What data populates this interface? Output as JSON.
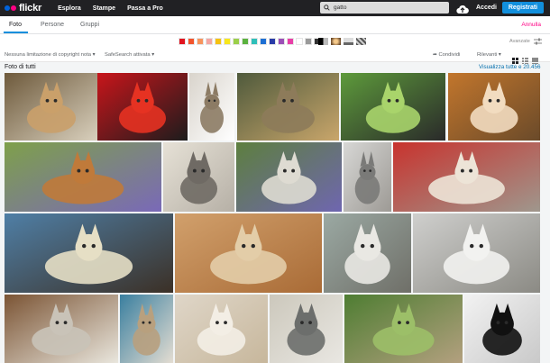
{
  "app": {
    "name": "flickr",
    "nav": [
      "Esplora",
      "Stampe",
      "Passa a Pro"
    ],
    "search_value": "gatto",
    "login_label": "Accedi",
    "signup_label": "Registrati"
  },
  "tabs": {
    "items": [
      "Foto",
      "Persone",
      "Gruppi"
    ],
    "active": "Foto",
    "cancel_label": "Annulla"
  },
  "filters": {
    "colors": [
      "#e1141f",
      "#f2542d",
      "#f7945d",
      "#f4a6a3",
      "#f5c211",
      "#f8e71c",
      "#9bcf4a",
      "#5bb23f",
      "#2fbfb9",
      "#1d6fd3",
      "#293ca7",
      "#9b4fb6",
      "#e83ea7",
      "#ffffff",
      "#9a9a9a",
      "#333333"
    ],
    "tones_icons": [
      "bw-icon",
      "shallow-depth-icon",
      "minimal-icon",
      "pattern-icon"
    ],
    "advanced_label": "Avanzate"
  },
  "options": {
    "license": "Nessuna limitazione di copyright nota",
    "safesearch": "SafeSearch attivata",
    "share": "Condividi",
    "sort": "Rilevanti"
  },
  "results": {
    "title": "Foto di tutti",
    "view_all": "Visualizza tutte e 20.456"
  },
  "photos": [
    {
      "name": "cat-photo-tabby-face"
    },
    {
      "name": "cat-photo-red-fabric"
    },
    {
      "name": "cat-photo-sitting-kitten"
    },
    {
      "name": "cat-photo-tabby-wood"
    },
    {
      "name": "cat-photo-siamese-grass"
    },
    {
      "name": "cat-photo-orange-kitten"
    },
    {
      "name": "cat-photo-orange-lavender"
    },
    {
      "name": "cat-photo-tabby-window"
    },
    {
      "name": "cat-photo-white-lavender"
    },
    {
      "name": "cat-photo-window-sill"
    },
    {
      "name": "cat-photo-pillows-sofa"
    },
    {
      "name": "cat-photo-map-lying"
    },
    {
      "name": "cat-photo-orange-sleeping"
    },
    {
      "name": "cat-photo-white-window"
    },
    {
      "name": "cat-photo-radiator-sleeping"
    },
    {
      "name": "cat-photo-two-cats-table"
    },
    {
      "name": "cat-photo-tabby-standing"
    },
    {
      "name": "cat-photo-white-sleeping"
    },
    {
      "name": "cat-photo-gray-window"
    },
    {
      "name": "cat-photo-tabby-garden"
    },
    {
      "name": "cat-photo-black-ladder"
    }
  ]
}
